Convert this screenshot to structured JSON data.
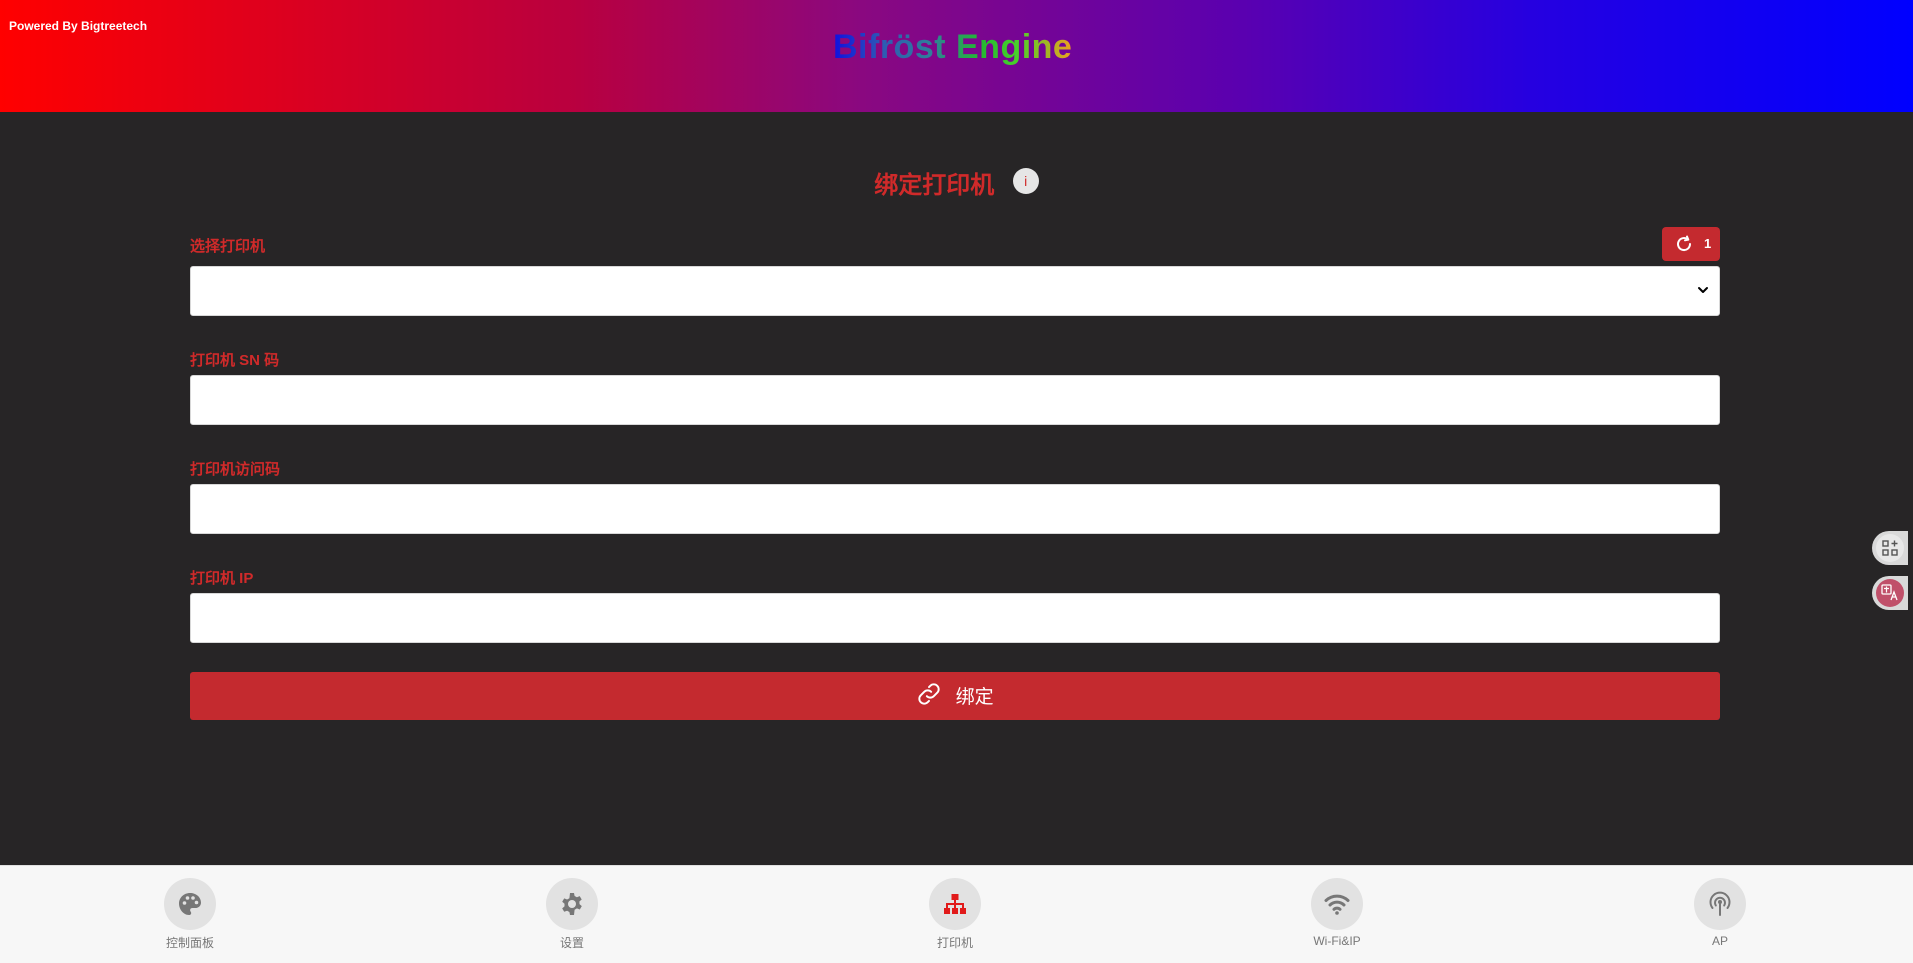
{
  "header": {
    "powered": "Powered By Bigtreetech",
    "brand": "Bifröst Engine"
  },
  "page": {
    "title": "绑定打印机",
    "info_icon": "i"
  },
  "form": {
    "select_label": "选择打印机",
    "select_value": "",
    "refresh_count": "1",
    "sn_label": "打印机 SN 码",
    "sn_value": "",
    "access_label": "打印机访问码",
    "access_value": "",
    "ip_label": "打印机 IP",
    "ip_value": "",
    "bind_label": "绑定"
  },
  "side": {
    "qr_icon": "qr-grid-icon",
    "translate_icon": "translate-icon"
  },
  "nav": {
    "items": [
      {
        "label": "控制面板",
        "icon": "palette-icon"
      },
      {
        "label": "设置",
        "icon": "gear-icon"
      },
      {
        "label": "打印机",
        "icon": "sitemap-icon",
        "active": true
      },
      {
        "label": "Wi-Fi&IP",
        "icon": "wifi-icon"
      },
      {
        "label": "AP",
        "icon": "broadcast-icon"
      }
    ]
  },
  "colors": {
    "accent": "#c42a2f",
    "background": "#272526",
    "active_icon": "#e11a1a"
  }
}
